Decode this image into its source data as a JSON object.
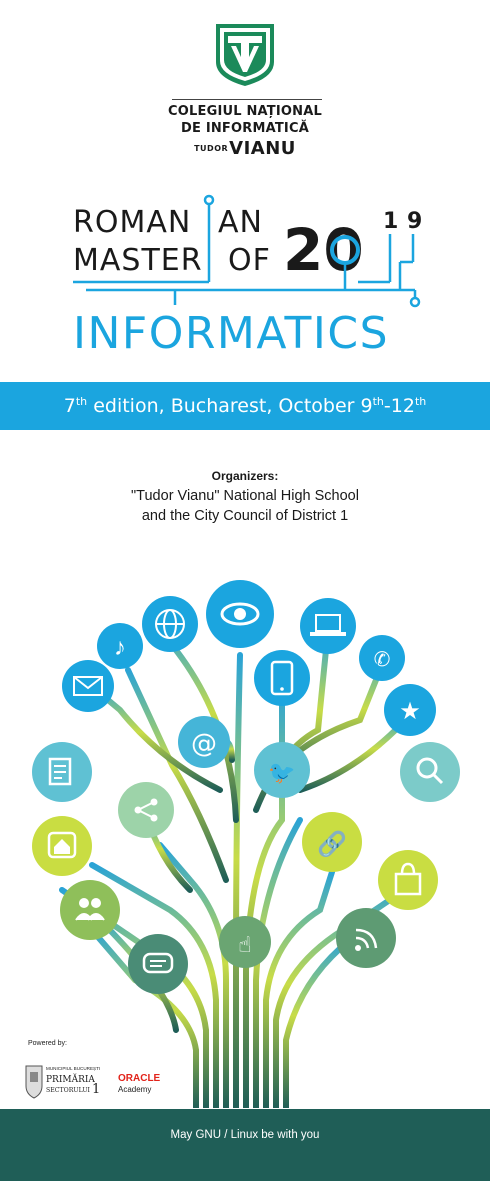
{
  "school": {
    "line1": "COLEGIUL NAȚIONAL",
    "line2": "DE INFORMATICĂ",
    "line3_small": "TUDOR",
    "line3_big": "VIANU",
    "logo_letters": "TV"
  },
  "event": {
    "word1": "ROMAN",
    "word2": "AN",
    "word3": "MASTER",
    "word4": "OF",
    "year_big": "20",
    "year_small1": "1",
    "year_small2": "9",
    "discipline": "INFORMATICS"
  },
  "edition": {
    "prefix": "7",
    "prefix_sup": "th",
    "middle": " edition, Bucharest, October 9",
    "mid_sup": "th",
    "dash": "-12",
    "end_sup": "th"
  },
  "organizers": {
    "label": "Organizers:",
    "line1": "\"Tudor Vianu\" National High School",
    "line2": "and the City Council of District 1"
  },
  "sponsors": {
    "powered_by": "Powered by:",
    "primaria_top": "MUNICIPIUL BUCUREȘTI",
    "primaria_mid": "PRIMĂRIA",
    "primaria_bottom": "SECTORULUI",
    "primaria_num": "1",
    "oracle": "ORACLE",
    "academy": "Academy"
  },
  "footer": {
    "text": "May GNU / Linux be with you"
  },
  "colors": {
    "accent_blue": "#1ba5df",
    "footer_teal": "#1f5e57",
    "logo_green": "#1b8a5a",
    "oracle_red": "#e2231a"
  },
  "tree_icons": [
    "music-icon",
    "globe-icon",
    "eye-icon",
    "laptop-icon",
    "phone-call-icon",
    "mail-icon",
    "mobile-icon",
    "star-icon",
    "at-icon",
    "notes-icon",
    "bird-icon",
    "zoom-icon",
    "share-icon",
    "home-icon",
    "link-icon",
    "shopping-bag-icon",
    "users-icon",
    "hand-icon",
    "rss-icon",
    "chat-icon"
  ]
}
